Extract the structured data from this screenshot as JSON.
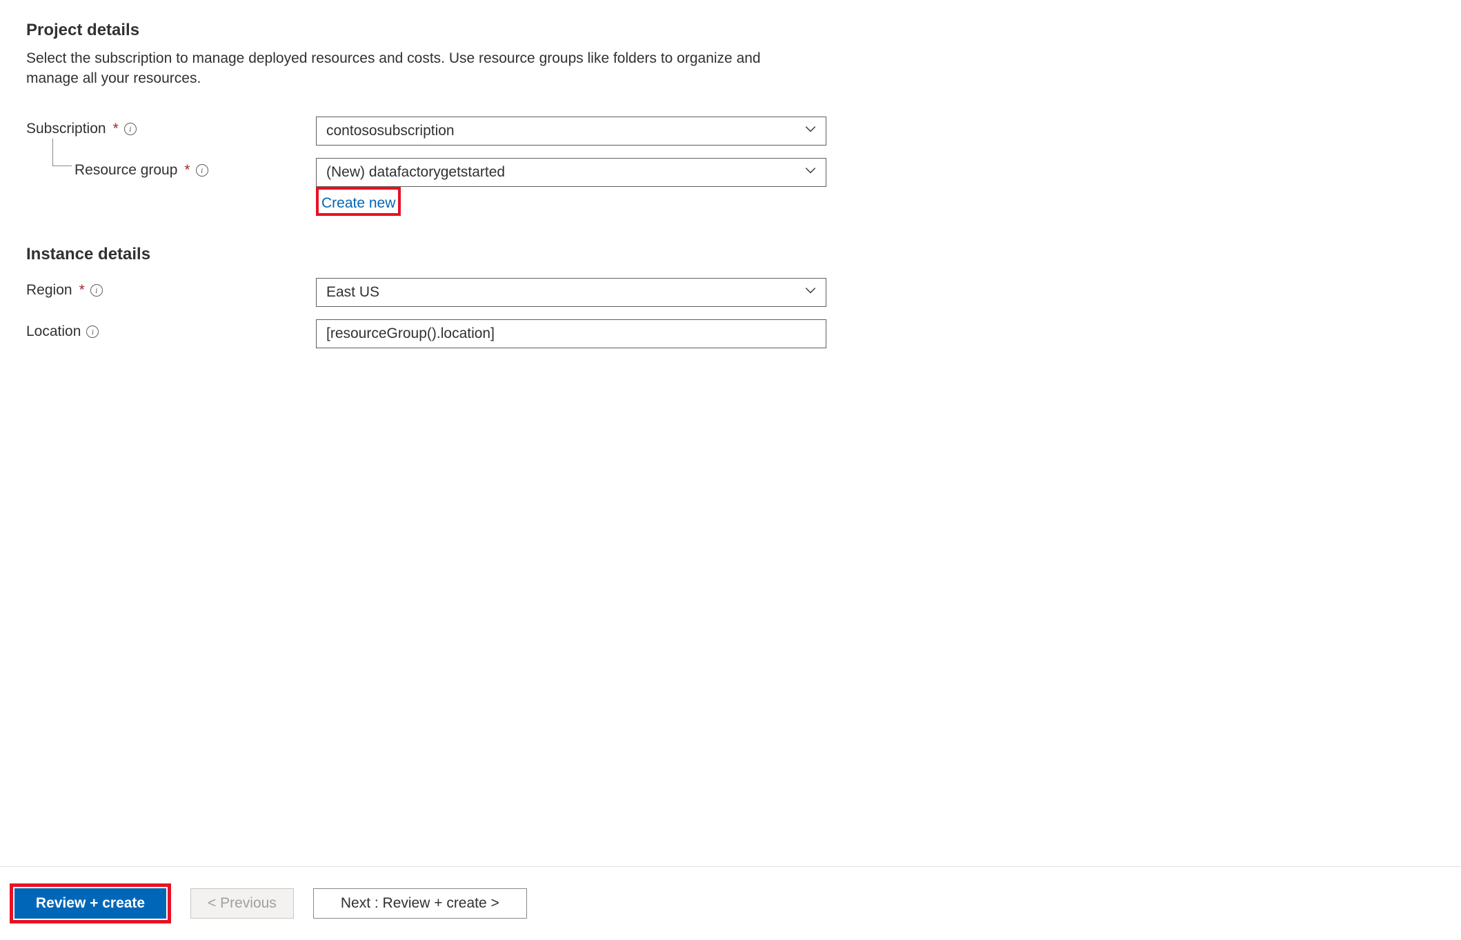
{
  "project_details": {
    "heading": "Project details",
    "description": "Select the subscription to manage deployed resources and costs. Use resource groups like folders to organize and manage all your resources.",
    "subscription": {
      "label": "Subscription",
      "value": "contososubscription"
    },
    "resource_group": {
      "label": "Resource group",
      "value": "(New) datafactorygetstarted",
      "create_new_label": "Create new"
    }
  },
  "instance_details": {
    "heading": "Instance details",
    "region": {
      "label": "Region",
      "value": "East US"
    },
    "location": {
      "label": "Location",
      "value": "[resourceGroup().location]"
    }
  },
  "footer": {
    "review_create": "Review + create",
    "previous": "< Previous",
    "next": "Next : Review + create >"
  }
}
